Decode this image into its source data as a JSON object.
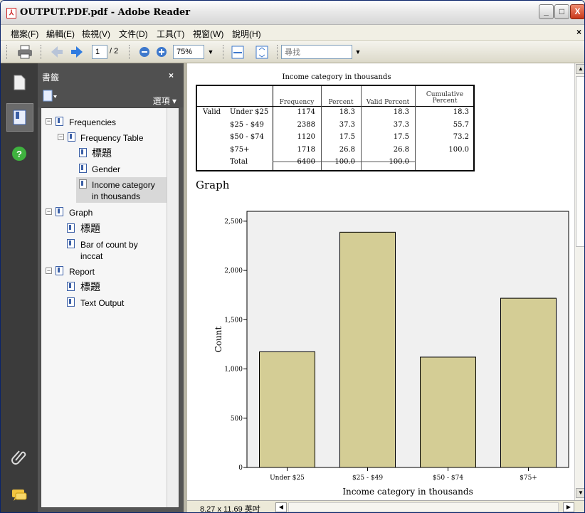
{
  "window": {
    "title": "OUTPUT.PDF.pdf - Adobe Reader",
    "min": "_",
    "max": "□",
    "close": "X"
  },
  "menu": [
    "檔案(F)",
    "編輯(E)",
    "檢視(V)",
    "文件(D)",
    "工具(T)",
    "視窗(W)",
    "說明(H)"
  ],
  "toolbar": {
    "page": "1",
    "page_total": "/ 2",
    "zoom": "75%",
    "search_placeholder": "尋找"
  },
  "panel": {
    "title": "書籤",
    "close": "×",
    "options": "選項 ▾"
  },
  "bookmarks": [
    {
      "label": "Frequencies"
    },
    {
      "label": "Frequency Table"
    },
    {
      "label": "標題"
    },
    {
      "label": "Gender"
    },
    {
      "label": "Income category",
      "label2": "in thousands"
    },
    {
      "label": "Graph"
    },
    {
      "label": "標題"
    },
    {
      "label": "Bar of count by",
      "label2": "inccat"
    },
    {
      "label": "Report"
    },
    {
      "label": "標題"
    },
    {
      "label": "Text Output"
    }
  ],
  "table": {
    "title": "Income category in thousands",
    "headers": [
      "Frequency",
      "Percent",
      "Valid Percent",
      "Cumulative",
      "Percent"
    ],
    "valid_label": "Valid",
    "rows": [
      {
        "label": "Under $25",
        "freq": "1174",
        "pct": "18.3",
        "valid": "18.3",
        "cum": "18.3"
      },
      {
        "label": "$25 - $49",
        "freq": "2388",
        "pct": "37.3",
        "valid": "37.3",
        "cum": "55.7"
      },
      {
        "label": "$50 - $74",
        "freq": "1120",
        "pct": "17.5",
        "valid": "17.5",
        "cum": "73.2"
      },
      {
        "label": "$75+",
        "freq": "1718",
        "pct": "26.8",
        "valid": "26.8",
        "cum": "100.0"
      },
      {
        "label": "Total",
        "freq": "6400",
        "pct": "100.0",
        "valid": "100.0",
        "cum": ""
      }
    ]
  },
  "section_title": "Graph",
  "chart_data": {
    "type": "bar",
    "categories": [
      "Under $25",
      "$25 - $49",
      "$50 - $74",
      "$75+"
    ],
    "values": [
      1174,
      2388,
      1120,
      1718
    ],
    "xlabel": "Income category in thousands",
    "ylabel": "Count",
    "yticks": [
      "0",
      "500",
      "1,000",
      "1,500",
      "2,000",
      "2,500"
    ],
    "ylim": [
      0,
      2600
    ],
    "bar_color": "#d4cd95"
  },
  "status": {
    "page_size": "8.27 x 11.69 英吋"
  }
}
